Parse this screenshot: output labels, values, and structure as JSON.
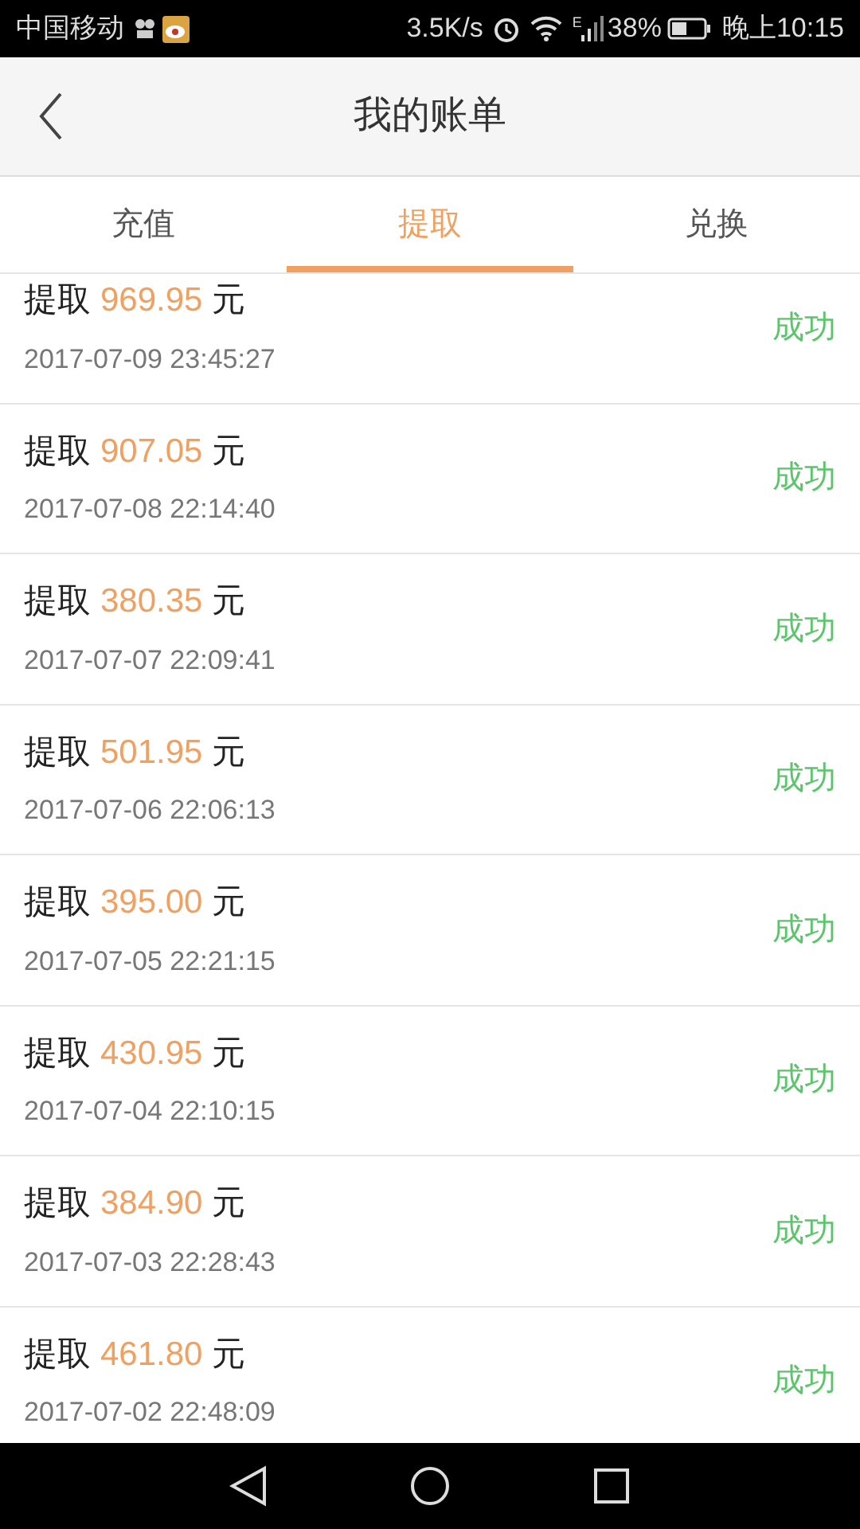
{
  "status_bar": {
    "carrier": "中国移动",
    "speed": "3.5K/s",
    "network": "E",
    "battery": "38%",
    "time": "晚上10:15"
  },
  "header": {
    "title": "我的账单"
  },
  "tabs": [
    {
      "label": "充值",
      "selected": false
    },
    {
      "label": "提取",
      "selected": true
    },
    {
      "label": "兑换",
      "selected": false
    }
  ],
  "records": [
    {
      "action": "提取",
      "amount": "969.95",
      "unit": "元",
      "time": "2017-07-09 23:45:27",
      "status": "成功"
    },
    {
      "action": "提取",
      "amount": "907.05",
      "unit": "元",
      "time": "2017-07-08 22:14:40",
      "status": "成功"
    },
    {
      "action": "提取",
      "amount": "380.35",
      "unit": "元",
      "time": "2017-07-07 22:09:41",
      "status": "成功"
    },
    {
      "action": "提取",
      "amount": "501.95",
      "unit": "元",
      "time": "2017-07-06 22:06:13",
      "status": "成功"
    },
    {
      "action": "提取",
      "amount": "395.00",
      "unit": "元",
      "time": "2017-07-05 22:21:15",
      "status": "成功"
    },
    {
      "action": "提取",
      "amount": "430.95",
      "unit": "元",
      "time": "2017-07-04 22:10:15",
      "status": "成功"
    },
    {
      "action": "提取",
      "amount": "384.90",
      "unit": "元",
      "time": "2017-07-03 22:28:43",
      "status": "成功"
    },
    {
      "action": "提取",
      "amount": "461.80",
      "unit": "元",
      "time": "2017-07-02 22:48:09",
      "status": "成功"
    }
  ]
}
